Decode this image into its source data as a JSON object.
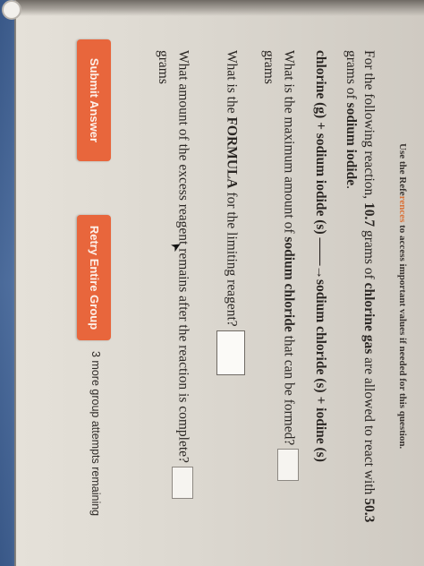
{
  "reference": {
    "prefix": "Use the Refe",
    "link": "rences",
    "suffix": " to access important values if needed for this question."
  },
  "question": {
    "intro_1": "For the following reaction, ",
    "chlorine_mass": "10.7",
    "intro_2": " grams of ",
    "chlorine_gas": "chlorine gas",
    "intro_3": " are allowed to react with ",
    "sodium_iodide_mass": "50.3",
    "intro_4": "grams of ",
    "sodium_iodide": "sodium iodide",
    "intro_5": ".",
    "equation": "chlorine (g) + sodium iodide (s) ——→sodium chloride (s) + iodine (s)",
    "q1_part1": "What is the maximum amount of ",
    "q1_bold": "sodium chloride",
    "q1_part2": " that can be formed?",
    "q1_unit": "grams",
    "q2_part1": "What is the ",
    "q2_bold": "FORMULA",
    "q2_part2": " for the limiting reagent?",
    "q3_text": "What amount of the excess reagent remains after the reaction is complete?",
    "q3_unit": "grams"
  },
  "buttons": {
    "submit": "Submit Answer",
    "retry": "Retry Entire Group"
  },
  "attempts_text": "3 more group attempts remaining",
  "colors": {
    "accent": "#e8663c",
    "text": "#2a2623"
  }
}
